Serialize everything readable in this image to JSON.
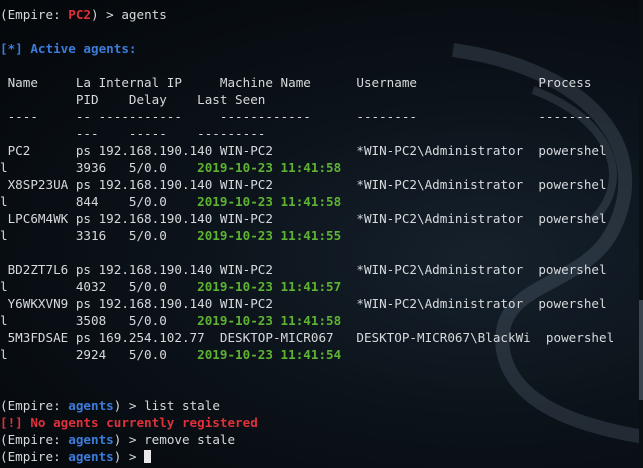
{
  "prompt": {
    "prefix": "(Empire: ",
    "suffix": ") > "
  },
  "history": {
    "host": "PC2",
    "command": "agents",
    "banner": "[*] Active agents:"
  },
  "table": {
    "header1": " Name     La Internal IP     Machine Name      Username                Process",
    "header2": "          PID    Delay    Last Seen",
    "sep1": " ----     -- -----------     ------------      --------                -------",
    "sep2": "          ---    -----    ---------",
    "rows": [
      {
        "main": " PC2      ps 192.168.190.140 WIN-PC2           *WIN-PC2\\Administrator  powershel",
        "sub": "l         3936   5/0.0    ",
        "last_seen": "2019-10-23 11:41:58"
      },
      {
        "main": " X8SP23UA ps 192.168.190.140 WIN-PC2           *WIN-PC2\\Administrator  powershel",
        "sub": "l         844    5/0.0    ",
        "last_seen": "2019-10-23 11:41:58"
      },
      {
        "main": " LPC6M4WK ps 192.168.190.140 WIN-PC2           *WIN-PC2\\Administrator  powershel",
        "sub": "l         3316   5/0.0    ",
        "last_seen": "2019-10-23 11:41:55"
      },
      {
        "main": " BD2ZT7L6 ps 192.168.190.140 WIN-PC2           *WIN-PC2\\Administrator  powershel",
        "sub": "l         4032   5/0.0    ",
        "last_seen": "2019-10-23 11:41:57"
      },
      {
        "main": " Y6WKXVN9 ps 192.168.190.140 WIN-PC2           *WIN-PC2\\Administrator  powershel",
        "sub": "l         3508   5/0.0    ",
        "last_seen": "2019-10-23 11:41:58"
      },
      {
        "main": " 5M3FDSAE ps 169.254.102.77  DESKTOP-MICR067   DESKTOP-MICR067\\BlackWi  powershel",
        "sub": "l         2924   5/0.0    ",
        "last_seen": "2019-10-23 11:41:54"
      }
    ]
  },
  "session": {
    "module": "agents",
    "cmd1": "list stale",
    "error": "[!] No agents currently registered",
    "cmd2": "remove stale"
  },
  "colors": {
    "host": "#e0303a",
    "module": "#3b7bd9",
    "last_seen": "#5fb332",
    "error": "#e0303a"
  }
}
